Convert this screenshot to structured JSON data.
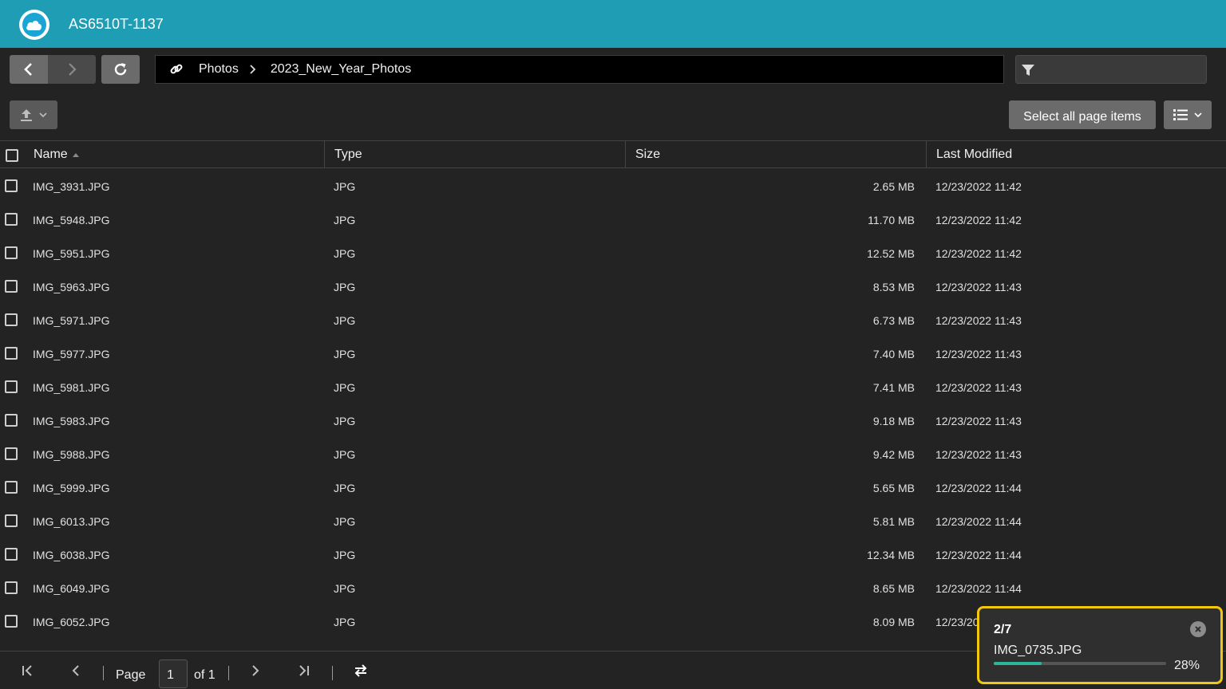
{
  "app": {
    "title": "AS6510T-1137"
  },
  "path": {
    "segments": [
      "Photos",
      "2023_New_Year_Photos"
    ]
  },
  "filter": {
    "placeholder": "",
    "value": ""
  },
  "toolbar": {
    "select_all_label": "Select all page items"
  },
  "table": {
    "headers": {
      "name": "Name",
      "type": "Type",
      "size": "Size",
      "modified": "Last Modified"
    },
    "sort": {
      "column": "name",
      "direction": "ascending"
    },
    "rows": [
      {
        "name": "IMG_3931.JPG",
        "type": "JPG",
        "size": "2.65 MB",
        "modified": "12/23/2022 11:42"
      },
      {
        "name": "IMG_5948.JPG",
        "type": "JPG",
        "size": "11.70 MB",
        "modified": "12/23/2022 11:42"
      },
      {
        "name": "IMG_5951.JPG",
        "type": "JPG",
        "size": "12.52 MB",
        "modified": "12/23/2022 11:42"
      },
      {
        "name": "IMG_5963.JPG",
        "type": "JPG",
        "size": "8.53 MB",
        "modified": "12/23/2022 11:43"
      },
      {
        "name": "IMG_5971.JPG",
        "type": "JPG",
        "size": "6.73 MB",
        "modified": "12/23/2022 11:43"
      },
      {
        "name": "IMG_5977.JPG",
        "type": "JPG",
        "size": "7.40 MB",
        "modified": "12/23/2022 11:43"
      },
      {
        "name": "IMG_5981.JPG",
        "type": "JPG",
        "size": "7.41 MB",
        "modified": "12/23/2022 11:43"
      },
      {
        "name": "IMG_5983.JPG",
        "type": "JPG",
        "size": "9.18 MB",
        "modified": "12/23/2022 11:43"
      },
      {
        "name": "IMG_5988.JPG",
        "type": "JPG",
        "size": "9.42 MB",
        "modified": "12/23/2022 11:43"
      },
      {
        "name": "IMG_5999.JPG",
        "type": "JPG",
        "size": "5.65 MB",
        "modified": "12/23/2022 11:44"
      },
      {
        "name": "IMG_6013.JPG",
        "type": "JPG",
        "size": "5.81 MB",
        "modified": "12/23/2022 11:44"
      },
      {
        "name": "IMG_6038.JPG",
        "type": "JPG",
        "size": "12.34 MB",
        "modified": "12/23/2022 11:44"
      },
      {
        "name": "IMG_6049.JPG",
        "type": "JPG",
        "size": "8.65 MB",
        "modified": "12/23/2022 11:44"
      },
      {
        "name": "IMG_6052.JPG",
        "type": "JPG",
        "size": "8.09 MB",
        "modified": "12/23/20"
      }
    ]
  },
  "pagination": {
    "page_label": "Page",
    "current_page": "1",
    "of_label": "of 1"
  },
  "upload": {
    "count": "2/7",
    "file": "IMG_0735.JPG",
    "percent_label": "28%",
    "progress": 0.28
  },
  "icons": {
    "logo": "cloud-icon",
    "back": "chevron-left-icon",
    "forward": "chevron-right-icon",
    "refresh": "refresh-icon",
    "link": "link-icon",
    "filter": "filter-icon",
    "upload": "upload-icon",
    "view": "list-view-icon",
    "close": "close-icon",
    "first": "first-page-icon",
    "prev": "prev-page-icon",
    "next": "next-page-icon",
    "last": "last-page-icon",
    "reload": "swap-icon"
  },
  "colors": {
    "header": "#1f9db4",
    "highlight": "#f2c80f",
    "progress": "#2bb59b"
  }
}
